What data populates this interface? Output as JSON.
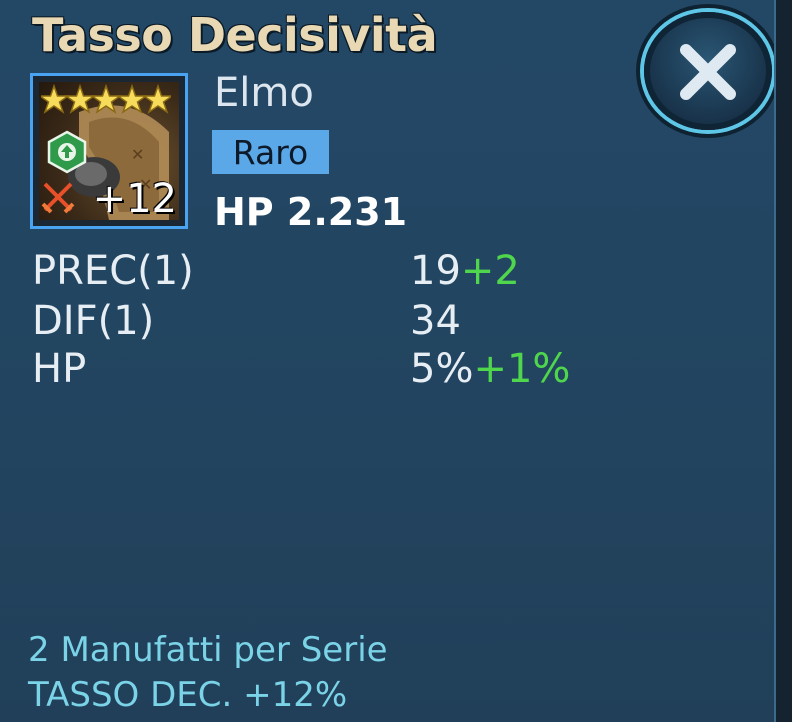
{
  "header": {
    "title": "Tasso Decisività"
  },
  "item": {
    "slot": "Elmo",
    "rarity": "Raro",
    "level": "+12",
    "stars": 5,
    "main_stat": "HP 2.231"
  },
  "substats": [
    {
      "name": "PREC(1)",
      "value": "19",
      "bonus": "+2"
    },
    {
      "name": "DIF(1)",
      "value": "34",
      "bonus": ""
    },
    {
      "name": "HP",
      "value": "5%",
      "bonus": "+1%"
    }
  ],
  "set_bonus": {
    "line1": "2 Manufatti per Serie",
    "line2": "TASSO DEC. +12%"
  },
  "icons": {
    "close": "close-icon",
    "star": "star-icon",
    "upgrade": "upgrade-arrow-icon",
    "set": "crossed-swords-icon"
  },
  "colors": {
    "bonus": "#4fd64c",
    "rarity_bg": "#5ba8e8",
    "set_text": "#7ad3e6"
  }
}
